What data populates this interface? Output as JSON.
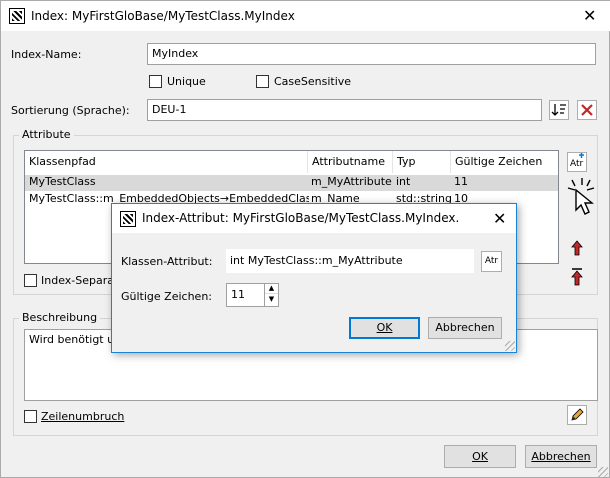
{
  "window": {
    "title": "Index: MyFirstGloBase/MyTestClass.MyIndex",
    "index_name_label": "Index-Name:",
    "index_name_value": "MyIndex",
    "unique_label": "Unique",
    "casesensitive_label": "CaseSensitive",
    "sort_label": "Sortierung (Sprache):",
    "sort_value": "DEU-1",
    "attribute_group": "Attribute",
    "columns": [
      "Klassenpfad",
      "Attributname",
      "Typ",
      "Gültige Zeichen"
    ],
    "rows": [
      [
        "MyTestClass",
        "m_MyAttribute",
        "int",
        "11"
      ],
      [
        "MyTestClass::m_EmbeddedObjects→EmbeddedClass",
        "m_Name",
        "std::string",
        "10"
      ]
    ],
    "index_separator_label": "Index-Separat",
    "description_group": "Beschreibung",
    "description_text": "Wird benötigt um",
    "wrap_label": "Zeilenumbruch",
    "ok_label": "OK",
    "cancel_label": "Abbrechen"
  },
  "dialog": {
    "title": "Index-Attribut: MyFirstGloBase/MyTestClass.MyIndex.",
    "class_attr_label": "Klassen-Attribut:",
    "class_attr_value": "int  MyTestClass::m_MyAttribute",
    "attr_button_label": "Atr",
    "valid_chars_label": "Gültige Zeichen:",
    "valid_chars_value": "11",
    "ok_label": "OK",
    "cancel_label": "Abbrechen"
  },
  "colors": {
    "accent": "#0078d7",
    "selection": "#d9d9d9",
    "delete_red": "#c0282a"
  }
}
